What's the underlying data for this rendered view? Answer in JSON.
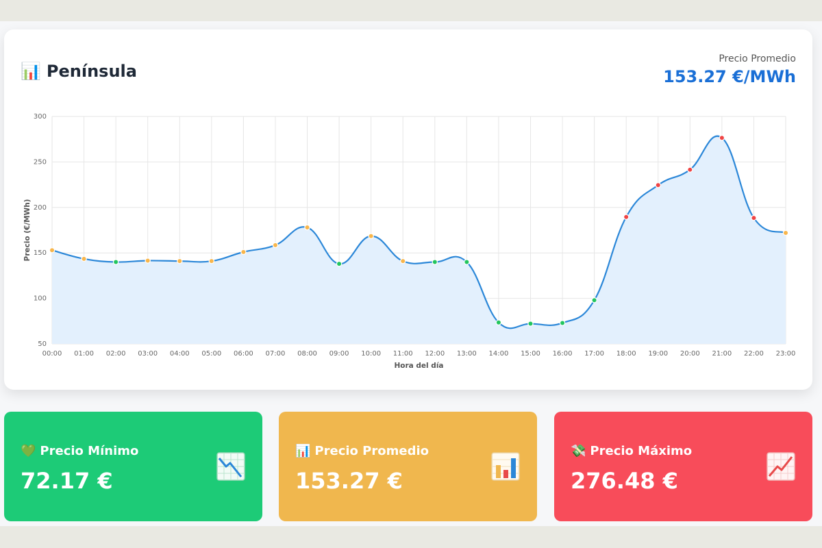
{
  "header": {
    "title_icon": "📊",
    "title": "Península",
    "avg_label": "Precio Promedio",
    "avg_value": "153.27 €/MWh"
  },
  "chart_data": {
    "type": "line",
    "area_fill": true,
    "xlabel": "Hora del día",
    "ylabel": "Precio (€/MWh)",
    "ylim": [
      50,
      300
    ],
    "yticks": [
      50,
      100,
      150,
      200,
      250,
      300
    ],
    "grid": true,
    "categories": [
      "00:00",
      "01:00",
      "02:00",
      "03:00",
      "04:00",
      "05:00",
      "06:00",
      "07:00",
      "08:00",
      "09:00",
      "10:00",
      "11:00",
      "12:00",
      "13:00",
      "14:00",
      "15:00",
      "16:00",
      "17:00",
      "18:00",
      "19:00",
      "20:00",
      "21:00",
      "22:00",
      "23:00"
    ],
    "series": [
      {
        "values": [
          153.0,
          143.5,
          140.0,
          141.5,
          141.0,
          141.0,
          151.0,
          158.5,
          178.0,
          138.0,
          168.5,
          141.0,
          140.0,
          140.0,
          73.5,
          72.17,
          73.0,
          98.0,
          189.5,
          224.5,
          241.5,
          276.48,
          188.5,
          172.0
        ],
        "point_colors": [
          "#f8b64c",
          "#f8b64c",
          "#22c55e",
          "#f8b64c",
          "#f8b64c",
          "#f8b64c",
          "#f8b64c",
          "#f8b64c",
          "#f8b64c",
          "#22c55e",
          "#f8b64c",
          "#f8b64c",
          "#22c55e",
          "#22c55e",
          "#22c55e",
          "#22c55e",
          "#22c55e",
          "#22c55e",
          "#ef4444",
          "#ef4444",
          "#ef4444",
          "#ef4444",
          "#ef4444",
          "#f8b64c"
        ]
      }
    ],
    "line_color": "#2b87d8",
    "fill_color": "#e3f0fd"
  },
  "stats": {
    "min": {
      "icon": "💚",
      "label": "Precio Mínimo",
      "value": "72.17 €",
      "icon_name": "chart-down-icon",
      "color": "#1dcb77"
    },
    "avg": {
      "icon": "📊",
      "label": "Precio Promedio",
      "value": "153.27 €",
      "icon_name": "bar-chart-icon",
      "color": "#f0b74e"
    },
    "max": {
      "icon": "💸",
      "label": "Precio Máximo",
      "value": "276.48 €",
      "icon_name": "chart-up-icon",
      "color": "#f84c5a"
    }
  }
}
